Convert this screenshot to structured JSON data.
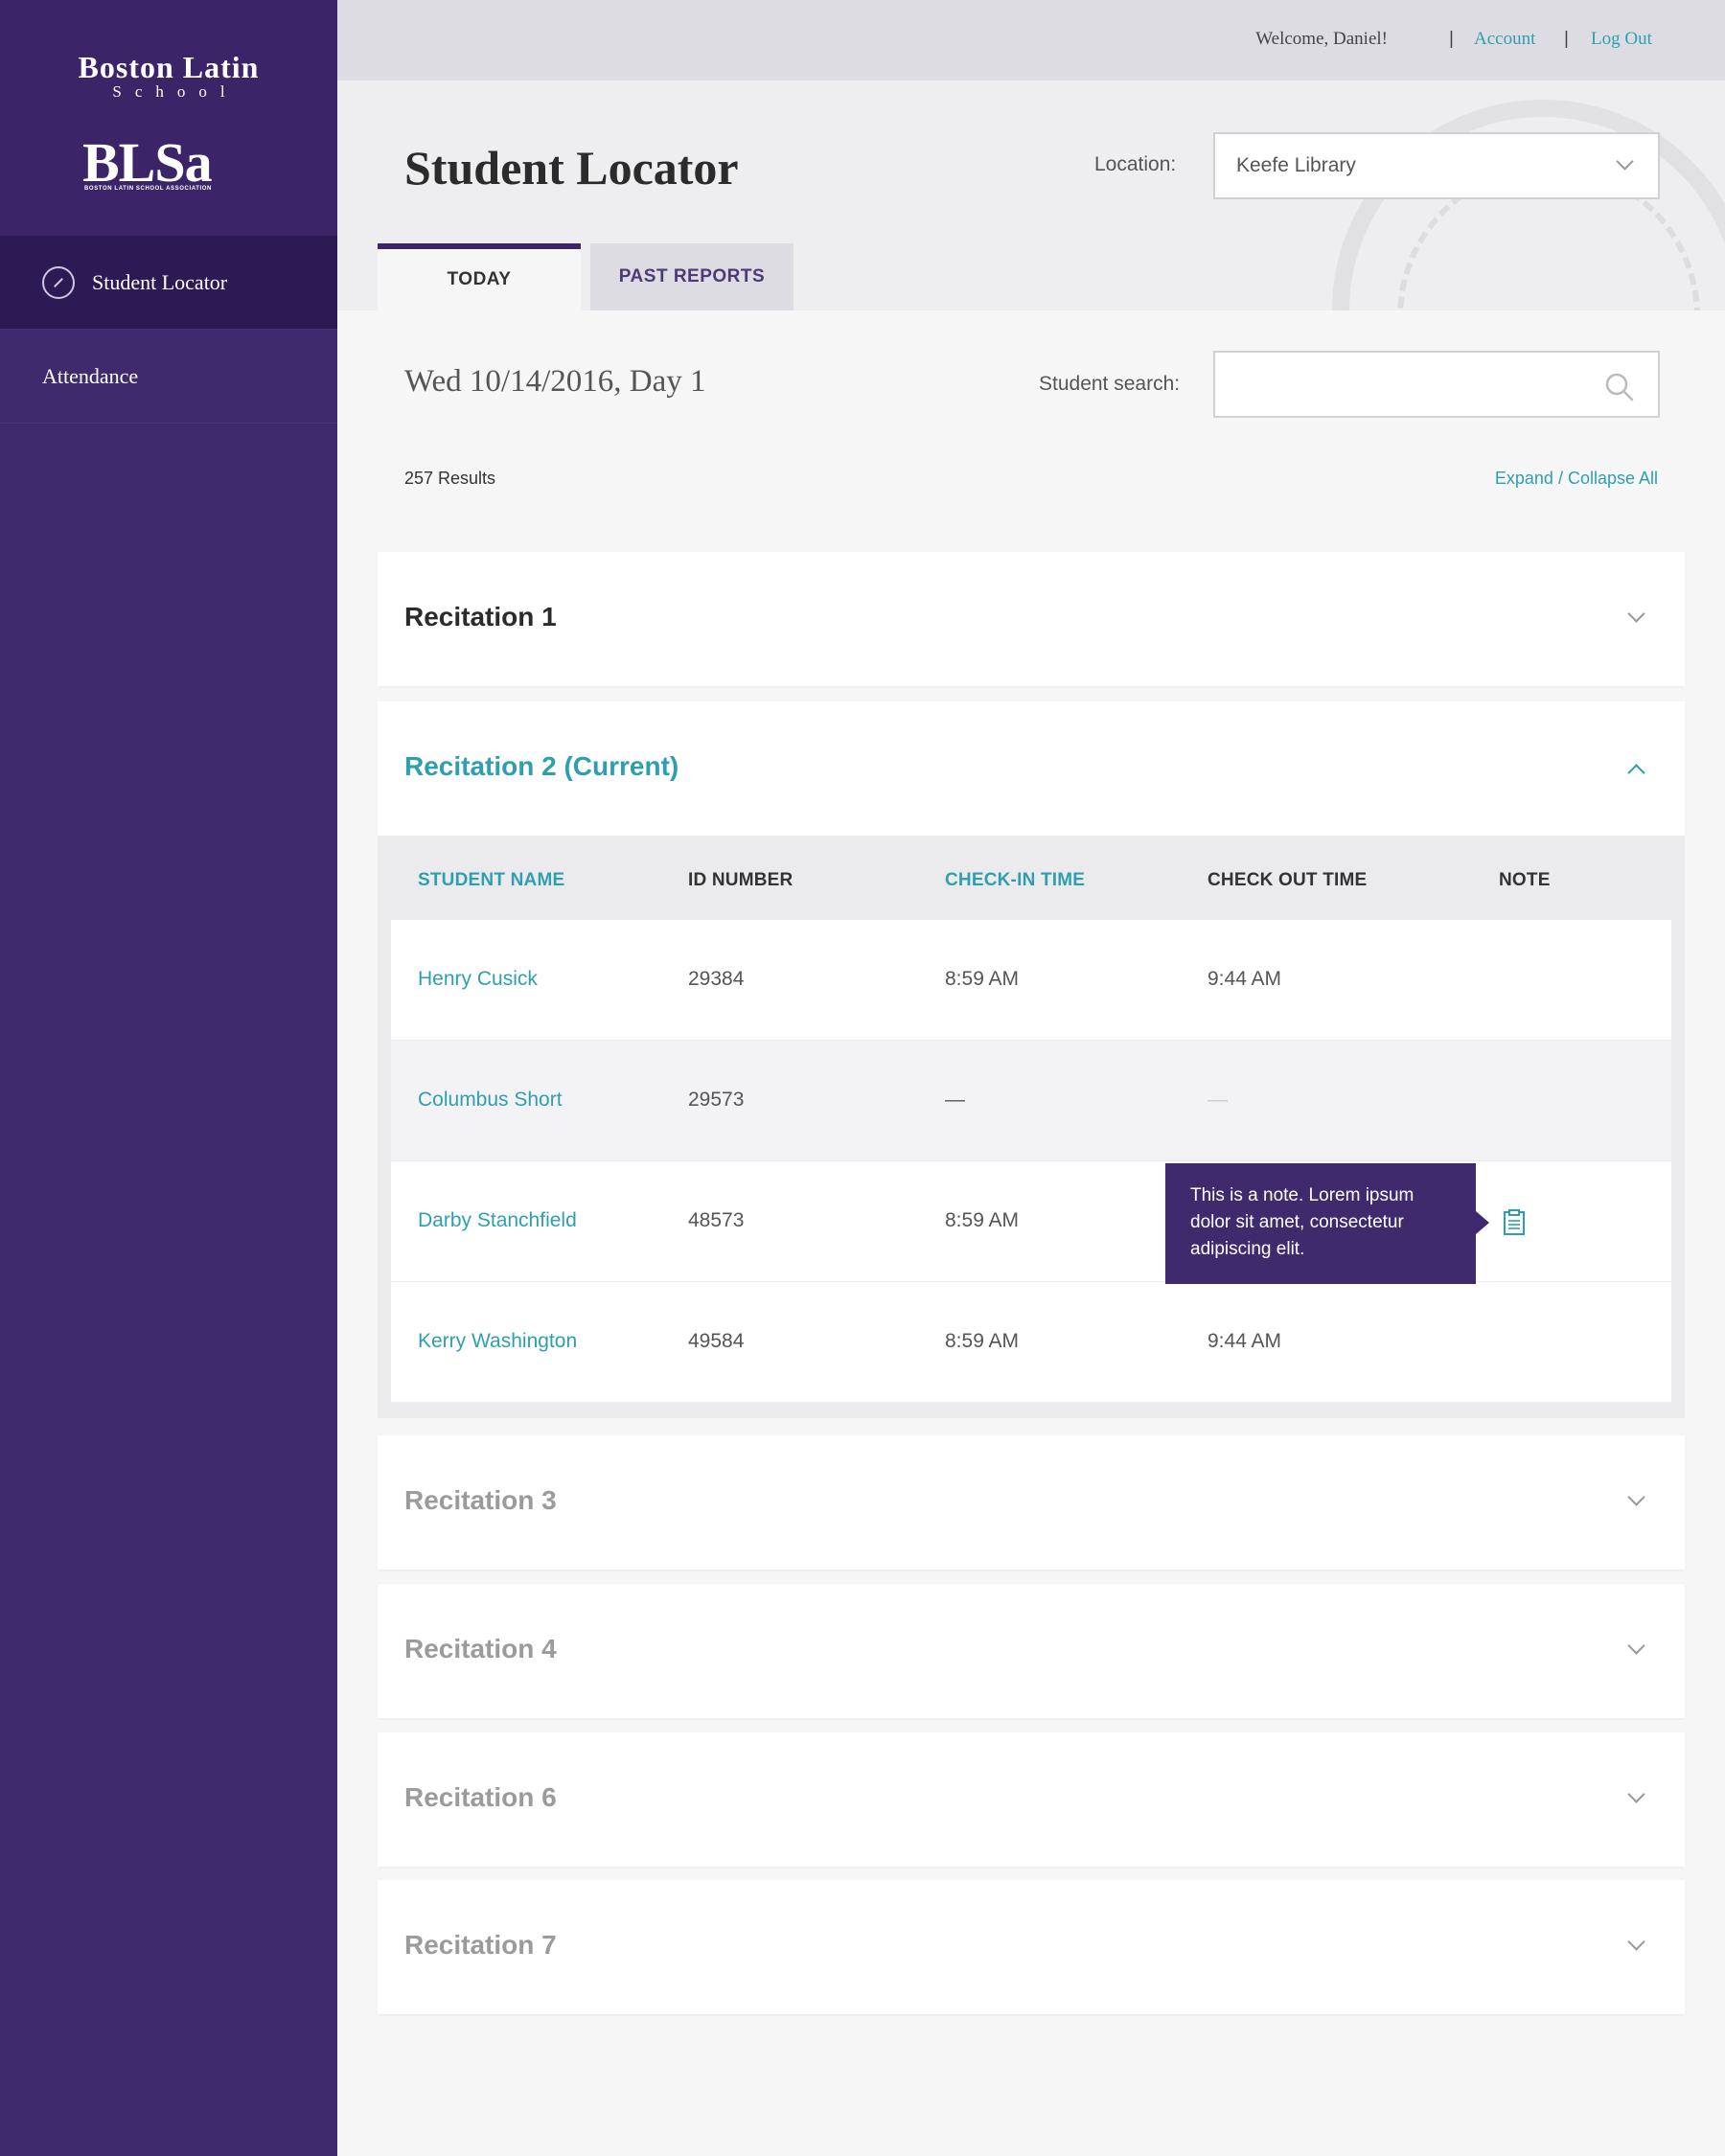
{
  "sidebar": {
    "brand_name": "Boston Latin",
    "brand_sub": "School",
    "logo_text": "BLSa",
    "logo_sub": "BOSTON LATIN SCHOOL ASSOCIATION",
    "items": [
      {
        "label": "Student Locator",
        "icon": "compass-icon",
        "active": true
      },
      {
        "label": "Attendance",
        "active": false
      }
    ]
  },
  "topbar": {
    "welcome": "Welcome, Daniel!",
    "separator": "|",
    "account": "Account",
    "logout": "Log Out"
  },
  "header": {
    "title": "Student Locator",
    "location_label": "Location:",
    "location_value": "Keefe Library",
    "tabs": [
      {
        "label": "TODAY",
        "active": true
      },
      {
        "label": "PAST REPORTS",
        "active": false
      }
    ]
  },
  "main": {
    "date": "Wed 10/14/2016, Day 1",
    "search_label": "Student search:",
    "search_value": "",
    "results": "257 Results",
    "expand_collapse": "Expand / Collapse All",
    "panels": [
      {
        "title": "Recitation 1",
        "expanded": false
      },
      {
        "title": "Recitation 2 (Current)",
        "expanded": true
      },
      {
        "title": "Recitation 3",
        "expanded": false
      },
      {
        "title": "Recitation 4",
        "expanded": false
      },
      {
        "title": "Recitation 6",
        "expanded": false
      },
      {
        "title": "Recitation 7",
        "expanded": false
      }
    ],
    "table": {
      "columns": [
        "STUDENT NAME",
        "ID NUMBER",
        "CHECK-IN TIME",
        "CHECK OUT TIME",
        "NOTE"
      ],
      "rows": [
        {
          "name": "Henry Cusick",
          "id": "29384",
          "check_in": "8:59 AM",
          "check_out": "9:44 AM",
          "note": ""
        },
        {
          "name": "Columbus Short",
          "id": "29573",
          "check_in": "—",
          "check_out": "—",
          "note": ""
        },
        {
          "name": "Darby Stanchfield",
          "id": "48573",
          "check_in": "8:59 AM",
          "check_out": "",
          "note": "This is a note. Lorem ipsum dolor sit amet, consectetur adipiscing elit."
        },
        {
          "name": "Kerry Washington",
          "id": "49584",
          "check_in": "8:59 AM",
          "check_out": "9:44 AM",
          "note": ""
        }
      ]
    }
  },
  "colors": {
    "sidebar": "#3f2a6e",
    "accent": "#2f9fb0",
    "title": "#2b2b2b"
  }
}
